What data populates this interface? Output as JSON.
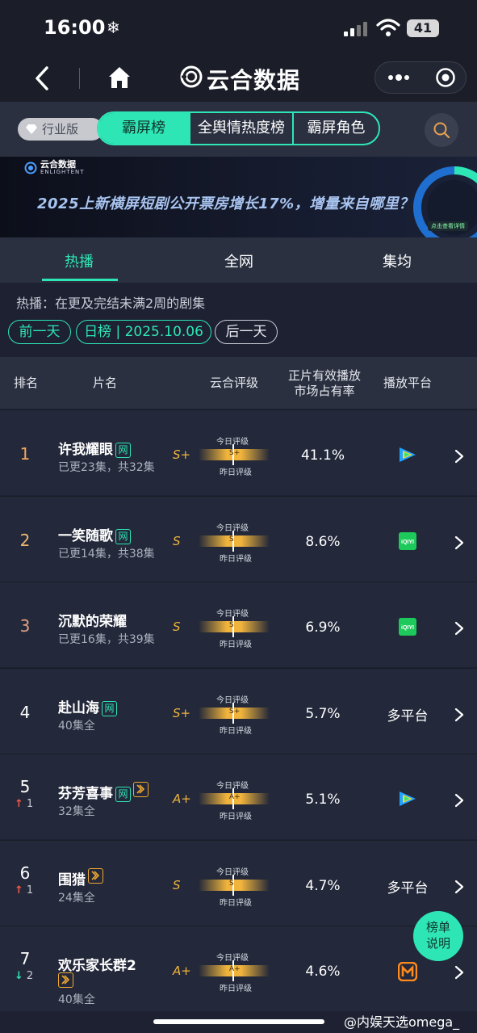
{
  "status_bar": {
    "time": "16:00",
    "time_icon": "snowflake-icon",
    "battery": "41"
  },
  "nav": {
    "title": "云合数据"
  },
  "filter": {
    "industry_label": "行业版",
    "tabs": [
      "霸屏榜",
      "全舆情热度榜",
      "霸屏角色"
    ],
    "active_tab": "霸屏榜"
  },
  "banner": {
    "brand": "云合数据",
    "brand_en": "ENLIGHTENT",
    "headline": "2025上新横屏短剧公开票房增长17%，增量来自哪里？",
    "mini_label": "点击查看详情"
  },
  "main_tabs": [
    "热播",
    "全网",
    "集均"
  ],
  "description": "热播：在更及完结未满2周的剧集",
  "date_nav": {
    "prev": "前一天",
    "current": "日榜 | 2025.10.06",
    "next": "后一天"
  },
  "table": {
    "headers": {
      "rank": "排名",
      "title": "片名",
      "rating": "云合评级",
      "share_line1": "正片有效播放",
      "share_line2": "市场占有率",
      "platform": "播放平台"
    },
    "scale_labels": {
      "today": "今日评级",
      "yesterday": "昨日评级"
    },
    "rows": [
      {
        "rank": "1",
        "change": "",
        "title": "许我耀眼",
        "badge": "网",
        "sub": "已更23集，共32集",
        "grade": "S+",
        "share": "41.1%",
        "platform": "",
        "platform_icon": "tencent-video-icon",
        "rank_color": "#f0a860"
      },
      {
        "rank": "2",
        "change": "",
        "title": "一笑随歌",
        "badge": "网",
        "sub": "已更14集，共38集",
        "grade": "S",
        "share": "8.6%",
        "platform": "",
        "platform_icon": "iqiyi-icon",
        "rank_color": "#f0b870"
      },
      {
        "rank": "3",
        "change": "",
        "title": "沉默的荣耀",
        "badge": "",
        "sub": "已更16集，共39集",
        "grade": "S",
        "share": "6.9%",
        "platform": "",
        "platform_icon": "iqiyi-icon",
        "rank_color": "#e0a080"
      },
      {
        "rank": "4",
        "change": "",
        "title": "赴山海",
        "badge": "网",
        "sub": "40集全",
        "grade": "S+",
        "share": "5.7%",
        "platform": "多平台",
        "platform_icon": "",
        "rank_color": "#ffffff"
      },
      {
        "rank": "5",
        "change": "1",
        "change_dir": "up",
        "title": "芬芳喜事",
        "badge": "网",
        "badge2": "play",
        "sub": "32集全",
        "grade": "A+",
        "share": "5.1%",
        "platform": "",
        "platform_icon": "tencent-video-icon",
        "rank_color": "#ffffff"
      },
      {
        "rank": "6",
        "change": "1",
        "change_dir": "up",
        "title": "围猎",
        "badge": "",
        "badge2": "play",
        "sub": "24集全",
        "grade": "S",
        "share": "4.7%",
        "platform": "多平台",
        "platform_icon": "",
        "rank_color": "#ffffff"
      },
      {
        "rank": "7",
        "change": "2",
        "change_dir": "down",
        "title": "欢乐家长群2",
        "badge": "",
        "badge2": "play",
        "sub": "40集全",
        "grade": "A+",
        "share": "4.6%",
        "platform": "",
        "platform_icon": "mango-tv-icon",
        "rank_color": "#ffffff"
      }
    ]
  },
  "help_bubble": {
    "line1": "榜单",
    "line2": "说明"
  },
  "footer_watermark": "@内娱天选omega_",
  "colors": {
    "accent": "#2ee6b5",
    "grade": "#f0b43c",
    "bg": "#1d2132",
    "row": "#23283a"
  }
}
